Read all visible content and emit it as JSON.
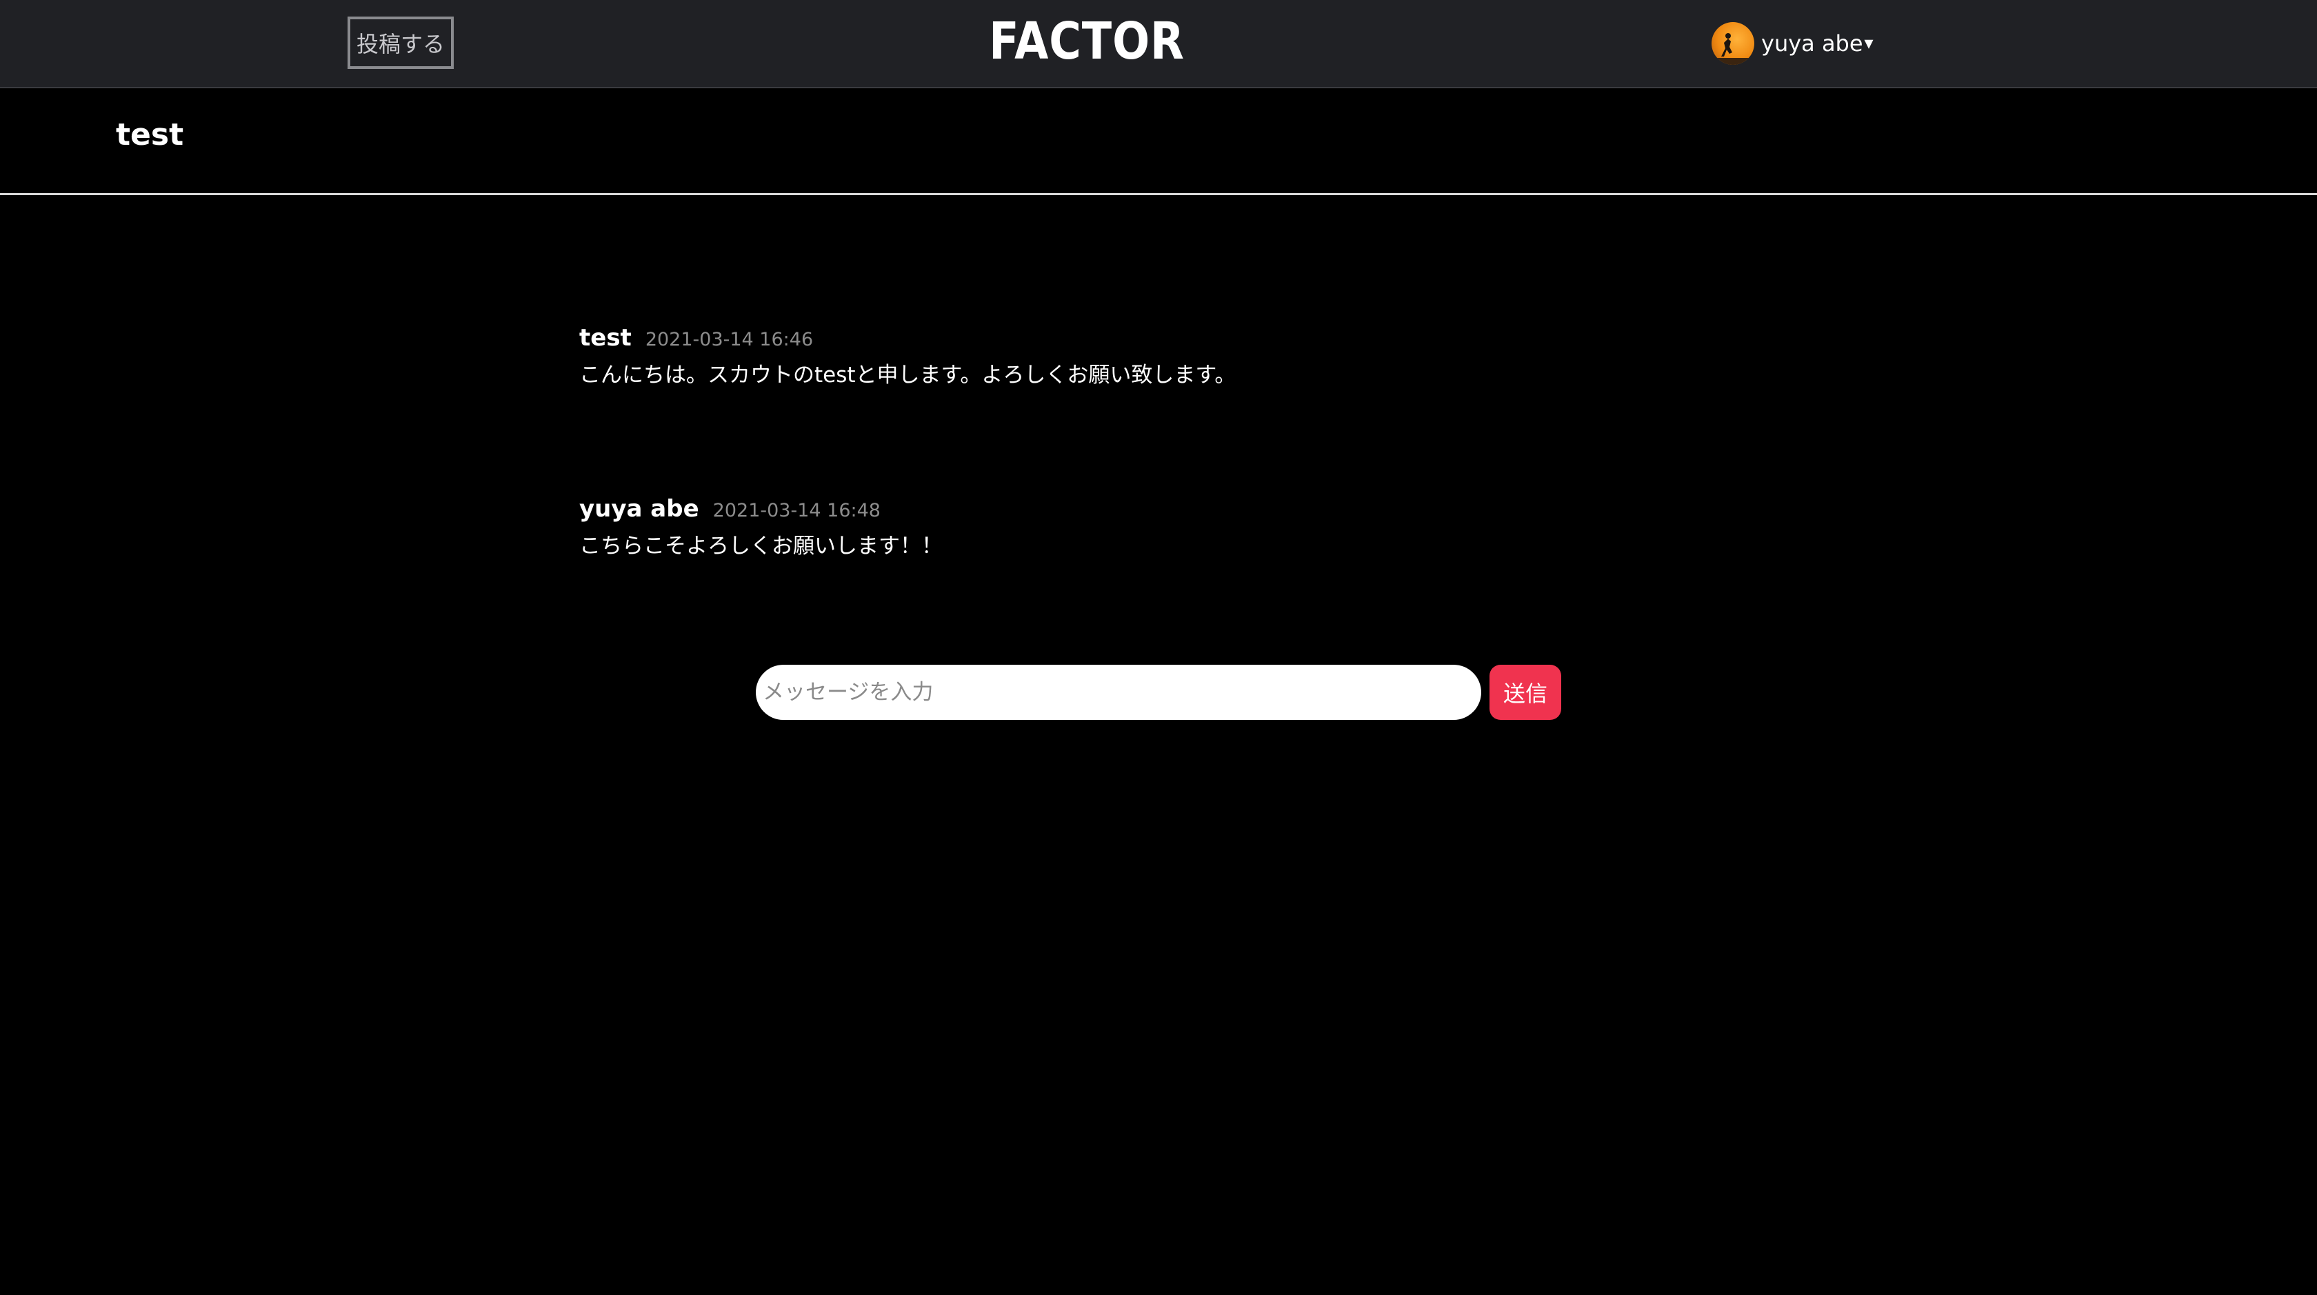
{
  "header": {
    "post_button_label": "投稿する",
    "logo_text": "FACTOR",
    "user": {
      "name": "yuya abe",
      "menu_caret": "▾",
      "avatar_icon": "avatar-image"
    }
  },
  "room": {
    "title": "test"
  },
  "messages": [
    {
      "author": "test",
      "timestamp": "2021-03-14 16:46",
      "body": "こんにちは。スカウトのtestと申します。よろしくお願い致します。"
    },
    {
      "author": "yuya abe",
      "timestamp": "2021-03-14 16:48",
      "body": "こちらこそよろしくお願いします！！"
    }
  ],
  "composer": {
    "input_value": "",
    "placeholder": "メッセージを入力",
    "send_label": "送信"
  },
  "colors": {
    "header_bg": "#202125",
    "page_bg": "#000000",
    "send_button": "#f0334f",
    "timestamp": "#8c8c8c"
  }
}
